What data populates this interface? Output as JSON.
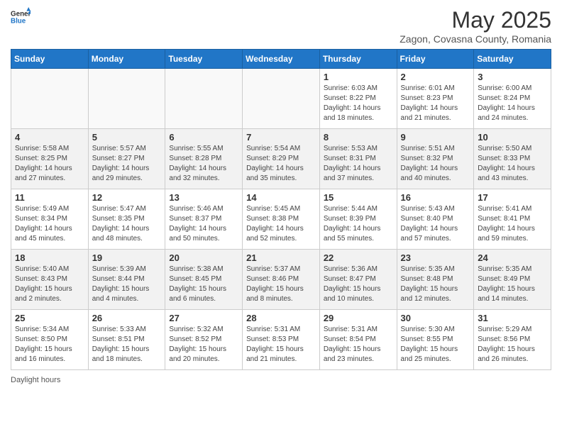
{
  "header": {
    "logo_general": "General",
    "logo_blue": "Blue",
    "month_year": "May 2025",
    "location": "Zagon, Covasna County, Romania"
  },
  "days_of_week": [
    "Sunday",
    "Monday",
    "Tuesday",
    "Wednesday",
    "Thursday",
    "Friday",
    "Saturday"
  ],
  "weeks": [
    [
      {
        "day": "",
        "info": ""
      },
      {
        "day": "",
        "info": ""
      },
      {
        "day": "",
        "info": ""
      },
      {
        "day": "",
        "info": ""
      },
      {
        "day": "1",
        "info": "Sunrise: 6:03 AM\nSunset: 8:22 PM\nDaylight: 14 hours\nand 18 minutes."
      },
      {
        "day": "2",
        "info": "Sunrise: 6:01 AM\nSunset: 8:23 PM\nDaylight: 14 hours\nand 21 minutes."
      },
      {
        "day": "3",
        "info": "Sunrise: 6:00 AM\nSunset: 8:24 PM\nDaylight: 14 hours\nand 24 minutes."
      }
    ],
    [
      {
        "day": "4",
        "info": "Sunrise: 5:58 AM\nSunset: 8:25 PM\nDaylight: 14 hours\nand 27 minutes."
      },
      {
        "day": "5",
        "info": "Sunrise: 5:57 AM\nSunset: 8:27 PM\nDaylight: 14 hours\nand 29 minutes."
      },
      {
        "day": "6",
        "info": "Sunrise: 5:55 AM\nSunset: 8:28 PM\nDaylight: 14 hours\nand 32 minutes."
      },
      {
        "day": "7",
        "info": "Sunrise: 5:54 AM\nSunset: 8:29 PM\nDaylight: 14 hours\nand 35 minutes."
      },
      {
        "day": "8",
        "info": "Sunrise: 5:53 AM\nSunset: 8:31 PM\nDaylight: 14 hours\nand 37 minutes."
      },
      {
        "day": "9",
        "info": "Sunrise: 5:51 AM\nSunset: 8:32 PM\nDaylight: 14 hours\nand 40 minutes."
      },
      {
        "day": "10",
        "info": "Sunrise: 5:50 AM\nSunset: 8:33 PM\nDaylight: 14 hours\nand 43 minutes."
      }
    ],
    [
      {
        "day": "11",
        "info": "Sunrise: 5:49 AM\nSunset: 8:34 PM\nDaylight: 14 hours\nand 45 minutes."
      },
      {
        "day": "12",
        "info": "Sunrise: 5:47 AM\nSunset: 8:35 PM\nDaylight: 14 hours\nand 48 minutes."
      },
      {
        "day": "13",
        "info": "Sunrise: 5:46 AM\nSunset: 8:37 PM\nDaylight: 14 hours\nand 50 minutes."
      },
      {
        "day": "14",
        "info": "Sunrise: 5:45 AM\nSunset: 8:38 PM\nDaylight: 14 hours\nand 52 minutes."
      },
      {
        "day": "15",
        "info": "Sunrise: 5:44 AM\nSunset: 8:39 PM\nDaylight: 14 hours\nand 55 minutes."
      },
      {
        "day": "16",
        "info": "Sunrise: 5:43 AM\nSunset: 8:40 PM\nDaylight: 14 hours\nand 57 minutes."
      },
      {
        "day": "17",
        "info": "Sunrise: 5:41 AM\nSunset: 8:41 PM\nDaylight: 14 hours\nand 59 minutes."
      }
    ],
    [
      {
        "day": "18",
        "info": "Sunrise: 5:40 AM\nSunset: 8:43 PM\nDaylight: 15 hours\nand 2 minutes."
      },
      {
        "day": "19",
        "info": "Sunrise: 5:39 AM\nSunset: 8:44 PM\nDaylight: 15 hours\nand 4 minutes."
      },
      {
        "day": "20",
        "info": "Sunrise: 5:38 AM\nSunset: 8:45 PM\nDaylight: 15 hours\nand 6 minutes."
      },
      {
        "day": "21",
        "info": "Sunrise: 5:37 AM\nSunset: 8:46 PM\nDaylight: 15 hours\nand 8 minutes."
      },
      {
        "day": "22",
        "info": "Sunrise: 5:36 AM\nSunset: 8:47 PM\nDaylight: 15 hours\nand 10 minutes."
      },
      {
        "day": "23",
        "info": "Sunrise: 5:35 AM\nSunset: 8:48 PM\nDaylight: 15 hours\nand 12 minutes."
      },
      {
        "day": "24",
        "info": "Sunrise: 5:35 AM\nSunset: 8:49 PM\nDaylight: 15 hours\nand 14 minutes."
      }
    ],
    [
      {
        "day": "25",
        "info": "Sunrise: 5:34 AM\nSunset: 8:50 PM\nDaylight: 15 hours\nand 16 minutes."
      },
      {
        "day": "26",
        "info": "Sunrise: 5:33 AM\nSunset: 8:51 PM\nDaylight: 15 hours\nand 18 minutes."
      },
      {
        "day": "27",
        "info": "Sunrise: 5:32 AM\nSunset: 8:52 PM\nDaylight: 15 hours\nand 20 minutes."
      },
      {
        "day": "28",
        "info": "Sunrise: 5:31 AM\nSunset: 8:53 PM\nDaylight: 15 hours\nand 21 minutes."
      },
      {
        "day": "29",
        "info": "Sunrise: 5:31 AM\nSunset: 8:54 PM\nDaylight: 15 hours\nand 23 minutes."
      },
      {
        "day": "30",
        "info": "Sunrise: 5:30 AM\nSunset: 8:55 PM\nDaylight: 15 hours\nand 25 minutes."
      },
      {
        "day": "31",
        "info": "Sunrise: 5:29 AM\nSunset: 8:56 PM\nDaylight: 15 hours\nand 26 minutes."
      }
    ]
  ],
  "footer": {
    "daylight_hours": "Daylight hours"
  }
}
